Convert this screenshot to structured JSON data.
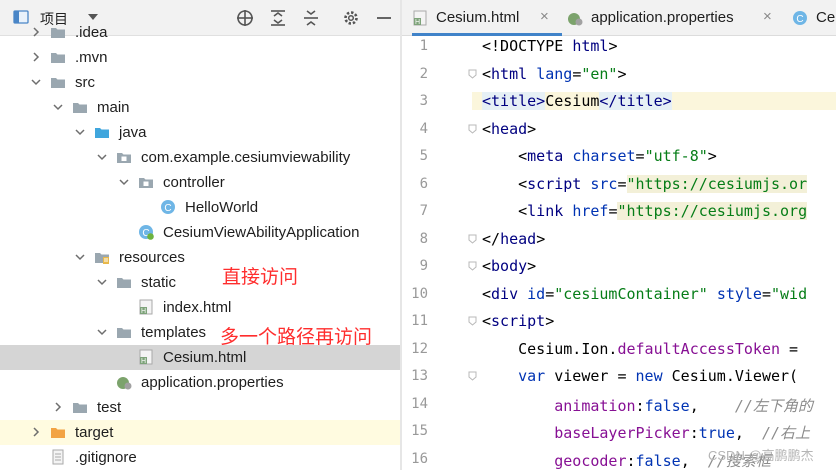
{
  "project_panel": {
    "title": "项目",
    "toolbar_icons": [
      "crosshair-icon",
      "expand-all-icon",
      "collapse-all-icon",
      "gear-icon",
      "minimize-icon"
    ]
  },
  "tree": [
    {
      "label": ".idea",
      "depth": 1,
      "type": "folder",
      "arrow": "right"
    },
    {
      "label": ".mvn",
      "depth": 1,
      "type": "folder",
      "arrow": "right"
    },
    {
      "label": "src",
      "depth": 1,
      "type": "folder",
      "arrow": "down"
    },
    {
      "label": "main",
      "depth": 2,
      "type": "folder",
      "arrow": "down"
    },
    {
      "label": "java",
      "depth": 3,
      "type": "folder-blue",
      "arrow": "down"
    },
    {
      "label": "com.example.cesiumviewability",
      "depth": 4,
      "type": "package",
      "arrow": "down"
    },
    {
      "label": "controller",
      "depth": 5,
      "type": "package",
      "arrow": "down"
    },
    {
      "label": "HelloWorld",
      "depth": 6,
      "type": "class",
      "arrow": "none"
    },
    {
      "label": "CesiumViewAbilityApplication",
      "depth": 5,
      "type": "spring-class",
      "arrow": "none"
    },
    {
      "label": "resources",
      "depth": 3,
      "type": "resources",
      "arrow": "down"
    },
    {
      "label": "static",
      "depth": 4,
      "type": "folder",
      "arrow": "down"
    },
    {
      "label": "index.html",
      "depth": 5,
      "type": "html",
      "arrow": "none"
    },
    {
      "label": "templates",
      "depth": 4,
      "type": "folder",
      "arrow": "down"
    },
    {
      "label": "Cesium.html",
      "depth": 5,
      "type": "html",
      "arrow": "none",
      "selected": true
    },
    {
      "label": "application.properties",
      "depth": 4,
      "type": "properties",
      "arrow": "none"
    },
    {
      "label": "test",
      "depth": 2,
      "type": "folder",
      "arrow": "right"
    },
    {
      "label": "target",
      "depth": 1,
      "type": "folder-orange",
      "arrow": "right",
      "highlight": true
    },
    {
      "label": ".gitignore",
      "depth": 1,
      "type": "file",
      "arrow": "none"
    }
  ],
  "annotations": {
    "direct": "直接访问",
    "extra_path": "多一个路径再访问"
  },
  "editor": {
    "tabs": [
      {
        "label": "Cesium.html",
        "icon": "html-file-icon",
        "active": true
      },
      {
        "label": "application.properties",
        "icon": "properties-file-icon",
        "active": false
      },
      {
        "label": "Ce",
        "icon": "class-icon",
        "active": false
      }
    ],
    "close_glyph": "×",
    "line_numbers": [
      "1",
      "2",
      "3",
      "4",
      "5",
      "6",
      "7",
      "8",
      "9",
      "10",
      "11",
      "12",
      "13",
      "14",
      "15",
      "16"
    ],
    "current_line": 3,
    "lines": [
      [
        [
          "plain",
          "<!DOCTYPE "
        ],
        [
          "tag",
          "html"
        ],
        [
          "plain",
          ">"
        ]
      ],
      [
        [
          "plain",
          "<"
        ],
        [
          "tag",
          "html "
        ],
        [
          "attr",
          "lang"
        ],
        [
          "plain",
          "="
        ],
        [
          "val",
          "\"en\""
        ],
        [
          "plain",
          ">"
        ]
      ],
      [
        [
          "tagh",
          "<title>"
        ],
        [
          "plain",
          "Cesium"
        ],
        [
          "tagh",
          "</title>"
        ]
      ],
      [
        [
          "plain",
          "<"
        ],
        [
          "tag",
          "head"
        ],
        [
          "plain",
          ">"
        ]
      ],
      [
        [
          "plain",
          "    <"
        ],
        [
          "tag",
          "meta "
        ],
        [
          "attr",
          "charset"
        ],
        [
          "plain",
          "="
        ],
        [
          "val",
          "\"utf-8\""
        ],
        [
          "plain",
          ">"
        ]
      ],
      [
        [
          "plain",
          "    <"
        ],
        [
          "tag",
          "script "
        ],
        [
          "attr",
          "src"
        ],
        [
          "plain",
          "="
        ],
        [
          "valbg",
          "\"https://cesiumjs.or"
        ]
      ],
      [
        [
          "plain",
          "    <"
        ],
        [
          "tag",
          "link "
        ],
        [
          "attr",
          "href"
        ],
        [
          "plain",
          "="
        ],
        [
          "valbg",
          "\"https://cesiumjs.org"
        ]
      ],
      [
        [
          "plain",
          "</"
        ],
        [
          "tag",
          "head"
        ],
        [
          "plain",
          ">"
        ]
      ],
      [
        [
          "plain",
          "<"
        ],
        [
          "tag",
          "body"
        ],
        [
          "plain",
          ">"
        ]
      ],
      [
        [
          "plain",
          "<"
        ],
        [
          "tag",
          "div "
        ],
        [
          "attr",
          "id"
        ],
        [
          "plain",
          "="
        ],
        [
          "val",
          "\"cesiumContainer\" "
        ],
        [
          "attr",
          "style"
        ],
        [
          "plain",
          "="
        ],
        [
          "val",
          "\"wid"
        ]
      ],
      [
        [
          "plain",
          "<"
        ],
        [
          "tag",
          "script"
        ],
        [
          "plain",
          ">"
        ]
      ],
      [
        [
          "plain",
          "    Cesium.Ion."
        ],
        [
          "ident",
          "defaultAccessToken"
        ],
        [
          "plain",
          " ="
        ]
      ],
      [
        [
          "plain",
          "    "
        ],
        [
          "kw",
          "var "
        ],
        [
          "plain",
          "viewer = "
        ],
        [
          "kw",
          "new "
        ],
        [
          "plain",
          "Cesium.Viewer("
        ]
      ],
      [
        [
          "plain",
          "        "
        ],
        [
          "ident",
          "animation"
        ],
        [
          "plain",
          ":"
        ],
        [
          "kw",
          "false"
        ],
        [
          "plain",
          ",    "
        ],
        [
          "cm",
          "//左下角的"
        ]
      ],
      [
        [
          "plain",
          "        "
        ],
        [
          "ident",
          "baseLayerPicker"
        ],
        [
          "plain",
          ":"
        ],
        [
          "kw",
          "true"
        ],
        [
          "plain",
          ",  "
        ],
        [
          "cm",
          "//右上"
        ]
      ],
      [
        [
          "plain",
          "        "
        ],
        [
          "ident",
          "geocoder"
        ],
        [
          "plain",
          ":"
        ],
        [
          "kw",
          "false"
        ],
        [
          "plain",
          ",  "
        ],
        [
          "cm",
          "//搜索框"
        ]
      ]
    ]
  },
  "watermark": "CSDN @高鹏鹏杰"
}
